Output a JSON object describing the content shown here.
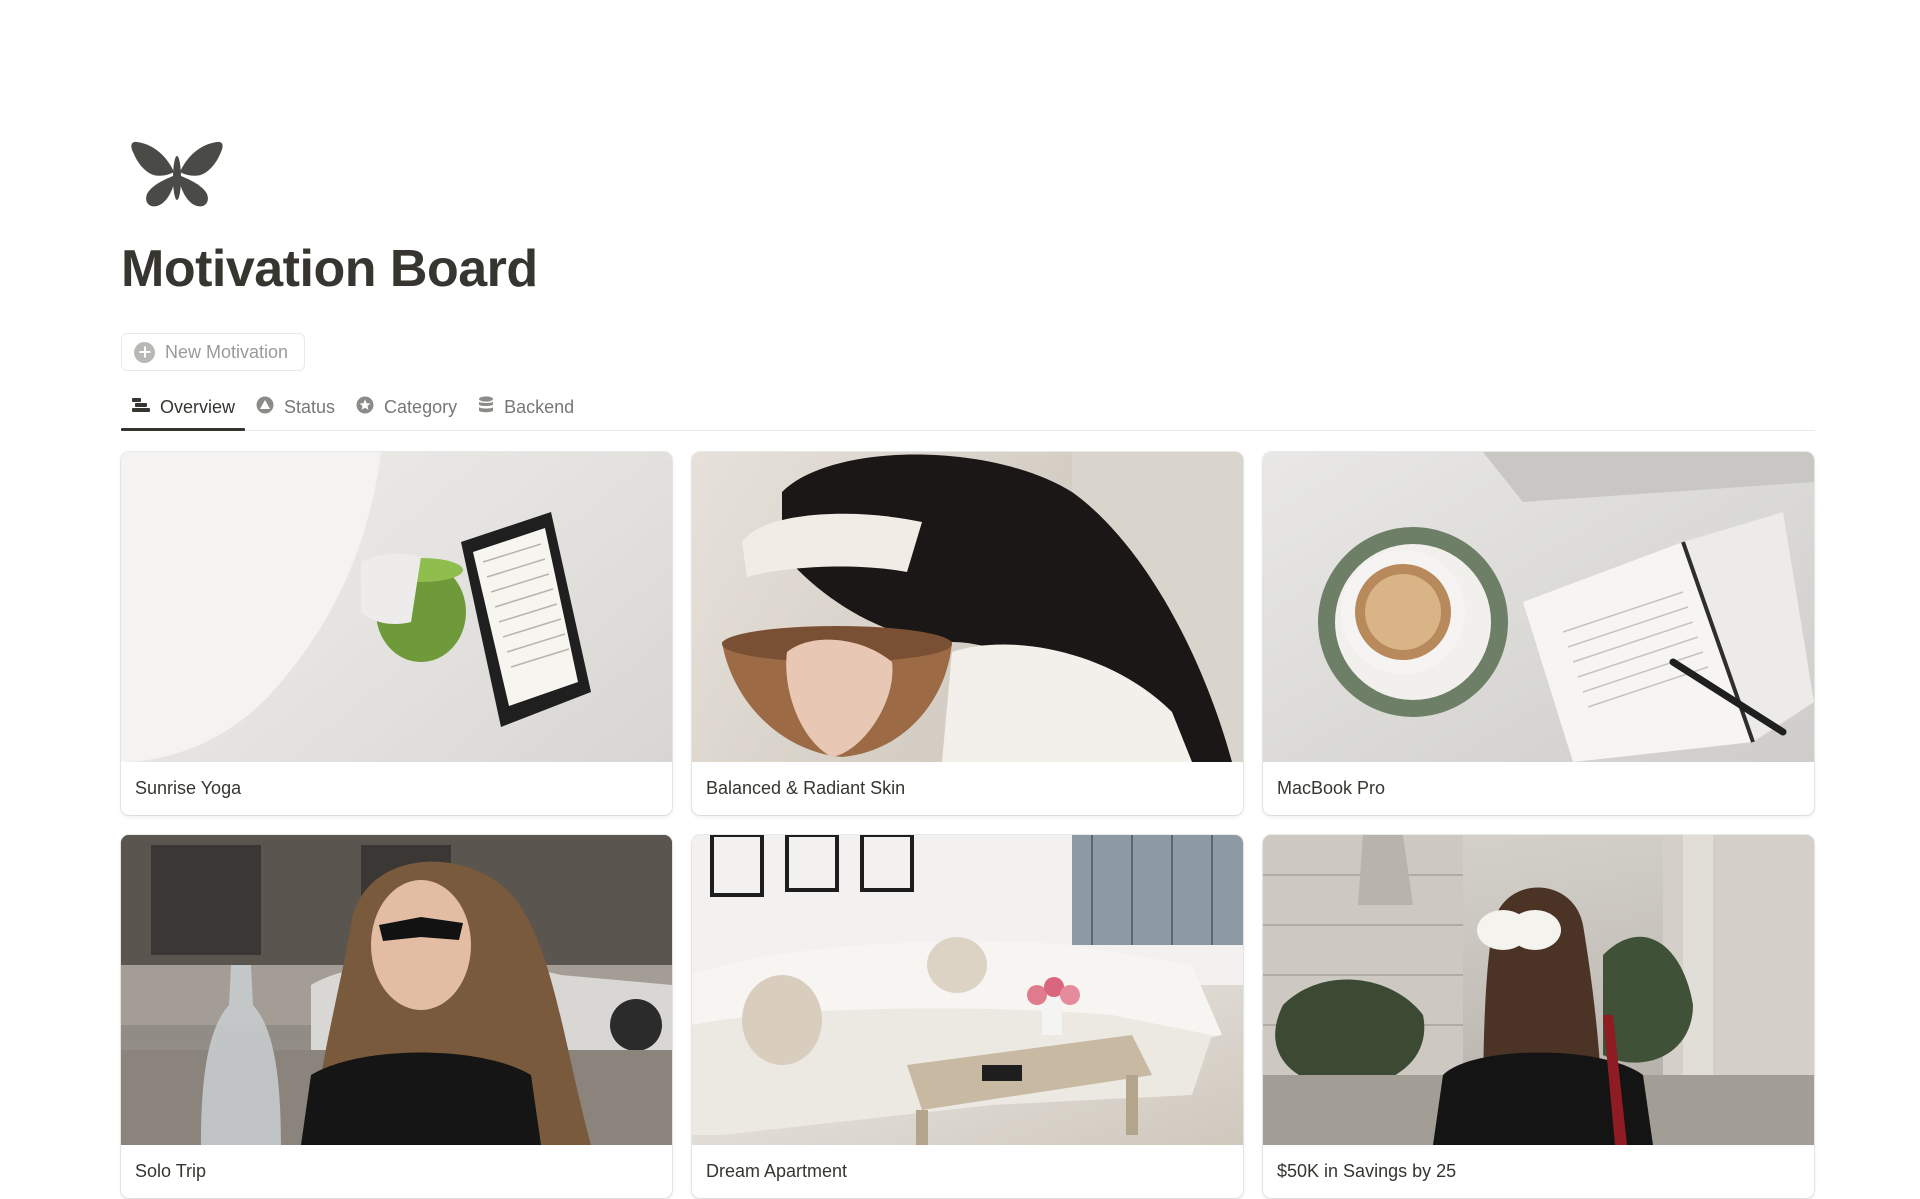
{
  "page": {
    "icon": "butterfly-icon",
    "title": "Motivation Board"
  },
  "toolbar": {
    "new_label": "New Motivation",
    "new_icon": "plus-circle-icon"
  },
  "tabs": [
    {
      "label": "Overview",
      "icon": "board-view-icon",
      "active": true
    },
    {
      "label": "Status",
      "icon": "status-icon",
      "active": false
    },
    {
      "label": "Category",
      "icon": "star-badge-icon",
      "active": false
    },
    {
      "label": "Backend",
      "icon": "database-icon",
      "active": false
    }
  ],
  "cards": [
    {
      "title": "Sunrise Yoga"
    },
    {
      "title": "Balanced & Radiant Skin"
    },
    {
      "title": "MacBook Pro"
    },
    {
      "title": "Solo Trip"
    },
    {
      "title": "Dream Apartment"
    },
    {
      "title": "$50K in Savings by 25"
    }
  ],
  "colors": {
    "text": "#37352f",
    "muted": "#787774",
    "border": "#e9e9e7",
    "icon": "#4a4a46"
  }
}
